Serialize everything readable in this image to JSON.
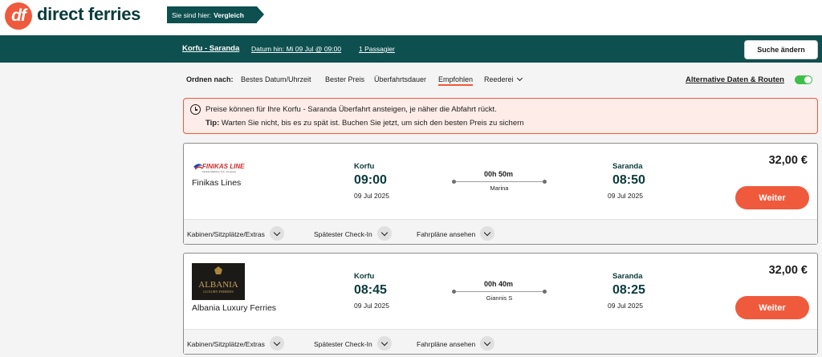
{
  "brand": {
    "logo_mark": "df",
    "name": "direct ferries",
    "color": "#f05a3c"
  },
  "breadcrumb": {
    "prefix": "Sie sind hier:",
    "current": "Vergleich"
  },
  "search": {
    "route": "Korfu - Saranda",
    "date": "Datum hin: Mi 09 Jul @ 09:00",
    "passengers": "1 Passagier",
    "change_button": "Suche ändern"
  },
  "sort": {
    "label": "Ordnen nach:",
    "options": [
      "Bestes Datum/Uhrzeit",
      "Bester Preis",
      "Überfahrtsdauer",
      "Empfohlen",
      "Reederei"
    ],
    "active": "Empfohlen",
    "alt_routes": "Alternative Daten & Routen",
    "alt_routes_enabled": true
  },
  "alert": {
    "line1": "Preise können für Ihre Korfu - Saranda Überfahrt ansteigen, je näher die Abfahrt rückt.",
    "tip_label": "Tip:",
    "tip_text": " Warten Sie nicht, bis es zu spät ist. Buchen Sie jetzt, um sich den besten Preis zu sichern"
  },
  "results": [
    {
      "operator": "Finikas Lines",
      "logo_text": "FINIKAS LINES",
      "logo_sub": "Finikas Maritime S.A. Company",
      "from_port": "Korfu",
      "from_time": "09:00",
      "from_date": "09 Jul 2025",
      "duration": "00h 50m",
      "vessel": "Marina",
      "to_port": "Saranda",
      "to_time": "08:50",
      "to_date": "09 Jul 2025",
      "price": "32,00 €",
      "cta": "Weiter"
    },
    {
      "operator": "Albania Luxury Ferries",
      "logo_text": "ALBANIA",
      "logo_sub": "LUXURY FERRIES",
      "from_port": "Korfu",
      "from_time": "08:45",
      "from_date": "09 Jul 2025",
      "duration": "00h 40m",
      "vessel": "Giannis S",
      "to_port": "Saranda",
      "to_time": "08:25",
      "to_date": "09 Jul 2025",
      "price": "32,00 €",
      "cta": "Weiter"
    }
  ],
  "card_footer": {
    "cabins": "Kabinen/Sitzplätze/Extras",
    "checkin": "Spätester Check-In",
    "timetables": "Fahrpläne ansehen"
  }
}
